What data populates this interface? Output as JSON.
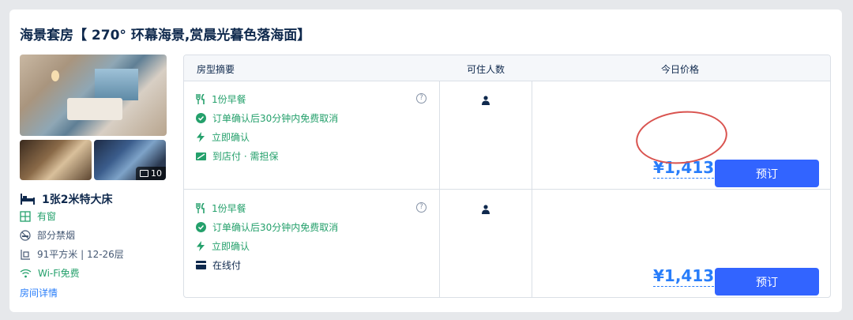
{
  "room": {
    "title": "海景套房【 270° 环幕海景,赏晨光暮色落海面】",
    "photo_count": "10",
    "bed": "1张2米特大床",
    "attributes": {
      "window": "有窗",
      "smoking": "部分禁烟",
      "area": "91平方米 | 12-26层",
      "wifi": "Wi-Fi免费"
    },
    "detail_link": "房间详情"
  },
  "table": {
    "headers": {
      "summary": "房型摘要",
      "occupancy": "可住人数",
      "price": "今日价格"
    },
    "rows": [
      {
        "breakfast": "1份早餐",
        "cancel": "订单确认后30分钟内免费取消",
        "confirm": "立即确认",
        "payment": "到店付 · 需担保",
        "price": "¥1,413",
        "book": "预订"
      },
      {
        "breakfast": "1份早餐",
        "cancel": "订单确认后30分钟内免费取消",
        "confirm": "立即确认",
        "payment": "在线付",
        "price": "¥1,413",
        "book": "预订"
      }
    ]
  },
  "colors": {
    "accent": "#287dfa",
    "button": "#3264ff",
    "green": "#24a06b",
    "highlight_circle": "#d9534f"
  },
  "icons": [
    "fork-knife-icon",
    "check-circle-icon",
    "lightning-icon",
    "pay-at-hotel-icon",
    "card-icon",
    "question-icon",
    "person-icon",
    "bed-icon",
    "window-icon",
    "no-smoking-icon",
    "area-icon",
    "wifi-icon",
    "image-icon"
  ]
}
